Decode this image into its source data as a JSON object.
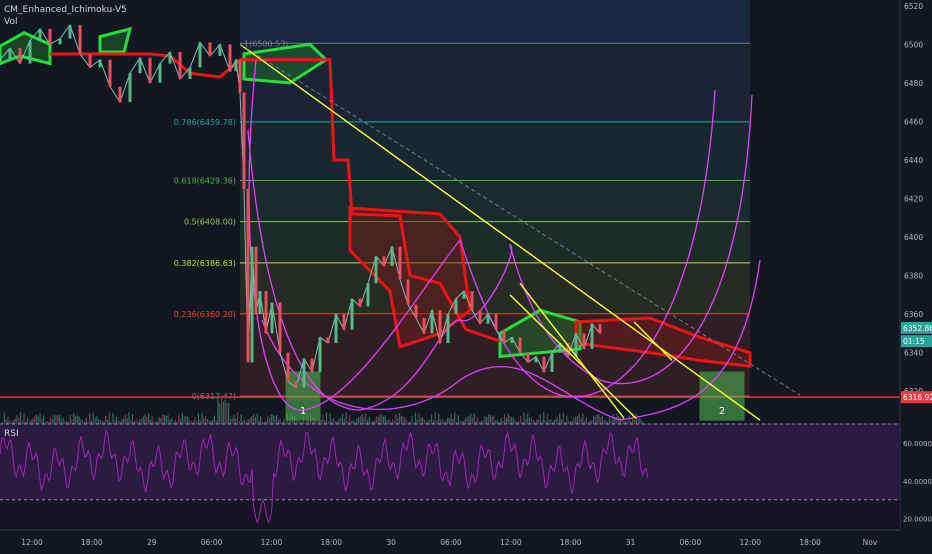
{
  "header": {
    "indicator": "CM_Enhanced_Ichimoku-V5",
    "vol": "Vol"
  },
  "rsi": {
    "label": "RSI",
    "ticks": [
      "60.0000",
      "40.0000",
      "20.0000"
    ],
    "tick_values": [
      60,
      40,
      20
    ],
    "range": [
      14,
      70
    ],
    "upper_band": 70,
    "lower_band": 30
  },
  "colors": {
    "background": "#131722",
    "cloud_bull": "#22e03a",
    "cloud_bear": "#ee1414",
    "fib_line": "#ffff33",
    "bands": "#e040fb",
    "resistance": "#ff2b2b",
    "price_badge": "#26a69a",
    "rsi_line": "#9c27b0"
  },
  "chart_data": {
    "type": "line",
    "title": "",
    "xlabel": "",
    "ylabel": "",
    "ylim": [
      6303,
      6523
    ],
    "y_ticks": [
      6520,
      6500,
      6480,
      6460,
      6440,
      6420,
      6400,
      6380,
      6360,
      6340,
      6320
    ],
    "x_ticks": [
      "12:00",
      "18:00",
      "29",
      "06:00",
      "12:00",
      "18:00",
      "30",
      "06:00",
      "12:00",
      "18:00",
      "31",
      "06:00",
      "12:00",
      "18:00",
      "Nov"
    ],
    "fib_levels": [
      {
        "label": "0.786(6459.78)",
        "value": 6459.78,
        "color": "#26a69a"
      },
      {
        "label": "0.618(6429.36)",
        "value": 6429.36,
        "color": "#4caf50"
      },
      {
        "label": "0.5(6408.00)",
        "value": 6408.0,
        "color": "#8bc34a"
      },
      {
        "label": "0.382(6386.63)",
        "value": 6386.63,
        "color": "#cddc39"
      },
      {
        "label": "0.236(6360.20)",
        "value": 6360.2,
        "color": "#f44336"
      },
      {
        "label": "0(6317.47)",
        "value": 6317.47,
        "color": "#787b86"
      }
    ],
    "fib_top_label": "1(6500.53)",
    "fib_top_value": 6500.53,
    "price_tags": [
      {
        "label": "6352.86",
        "value": 6352.86,
        "color": "#26a69a"
      },
      {
        "label": "01:15",
        "value": 6346.0,
        "color": "#26a69a"
      },
      {
        "label": "6316.92",
        "value": 6316.92,
        "color": "#f23645"
      }
    ],
    "resistance_value": 6316.92,
    "boxes": [
      {
        "label": "1",
        "x": [
          14.3,
          16.0
        ],
        "y": [
          6305,
          6330
        ]
      },
      {
        "label": "2",
        "x": [
          35.0,
          37.2
        ],
        "y": [
          6305,
          6330
        ]
      }
    ],
    "series": [
      {
        "values": [
          [
            0,
            6492
          ],
          [
            0.5,
            6498
          ],
          [
            1,
            6490
          ],
          [
            1.5,
            6502
          ],
          [
            2,
            6508
          ],
          [
            2.5,
            6500
          ],
          [
            3,
            6503
          ],
          [
            3.5,
            6510
          ],
          [
            4,
            6495
          ],
          [
            4.5,
            6488
          ],
          [
            5,
            6492
          ],
          [
            5.5,
            6478
          ],
          [
            6,
            6470
          ],
          [
            6.5,
            6485
          ],
          [
            7,
            6493
          ],
          [
            7.5,
            6480
          ],
          [
            8,
            6490
          ],
          [
            8.5,
            6496
          ],
          [
            9,
            6482
          ],
          [
            9.5,
            6488
          ],
          [
            10,
            6501
          ],
          [
            10.5,
            6494
          ],
          [
            11,
            6500
          ],
          [
            11.5,
            6486
          ],
          [
            11.8,
            6492
          ],
          [
            12,
            6475
          ],
          [
            12.2,
            6425
          ],
          [
            12.4,
            6335
          ],
          [
            12.6,
            6395
          ],
          [
            12.8,
            6360
          ],
          [
            13,
            6372
          ],
          [
            13.3,
            6350
          ],
          [
            13.6,
            6366
          ],
          [
            14,
            6340
          ],
          [
            14.4,
            6325
          ],
          [
            14.8,
            6322
          ],
          [
            15.2,
            6337
          ],
          [
            15.6,
            6330
          ],
          [
            16,
            6348
          ],
          [
            16.4,
            6345
          ],
          [
            16.8,
            6360
          ],
          [
            17.2,
            6352
          ],
          [
            17.6,
            6368
          ],
          [
            18,
            6364
          ],
          [
            18.4,
            6376
          ],
          [
            18.8,
            6390
          ],
          [
            19.2,
            6385
          ],
          [
            19.6,
            6395
          ],
          [
            20,
            6378
          ],
          [
            20.4,
            6365
          ],
          [
            20.8,
            6358
          ],
          [
            21.2,
            6350
          ],
          [
            21.6,
            6362
          ],
          [
            22,
            6345
          ],
          [
            22.4,
            6360
          ],
          [
            22.8,
            6368
          ],
          [
            23.2,
            6372
          ],
          [
            23.6,
            6362
          ],
          [
            24,
            6355
          ],
          [
            24.4,
            6360
          ],
          [
            24.8,
            6352
          ],
          [
            25.2,
            6345
          ],
          [
            25.6,
            6348
          ],
          [
            26,
            6340
          ],
          [
            26.4,
            6335
          ],
          [
            26.8,
            6338
          ],
          [
            27.2,
            6330
          ],
          [
            27.6,
            6340
          ],
          [
            28,
            6345
          ],
          [
            28.4,
            6338
          ],
          [
            28.8,
            6350
          ],
          [
            29.2,
            6342
          ],
          [
            29.6,
            6355
          ],
          [
            30,
            6350
          ]
        ]
      }
    ]
  }
}
